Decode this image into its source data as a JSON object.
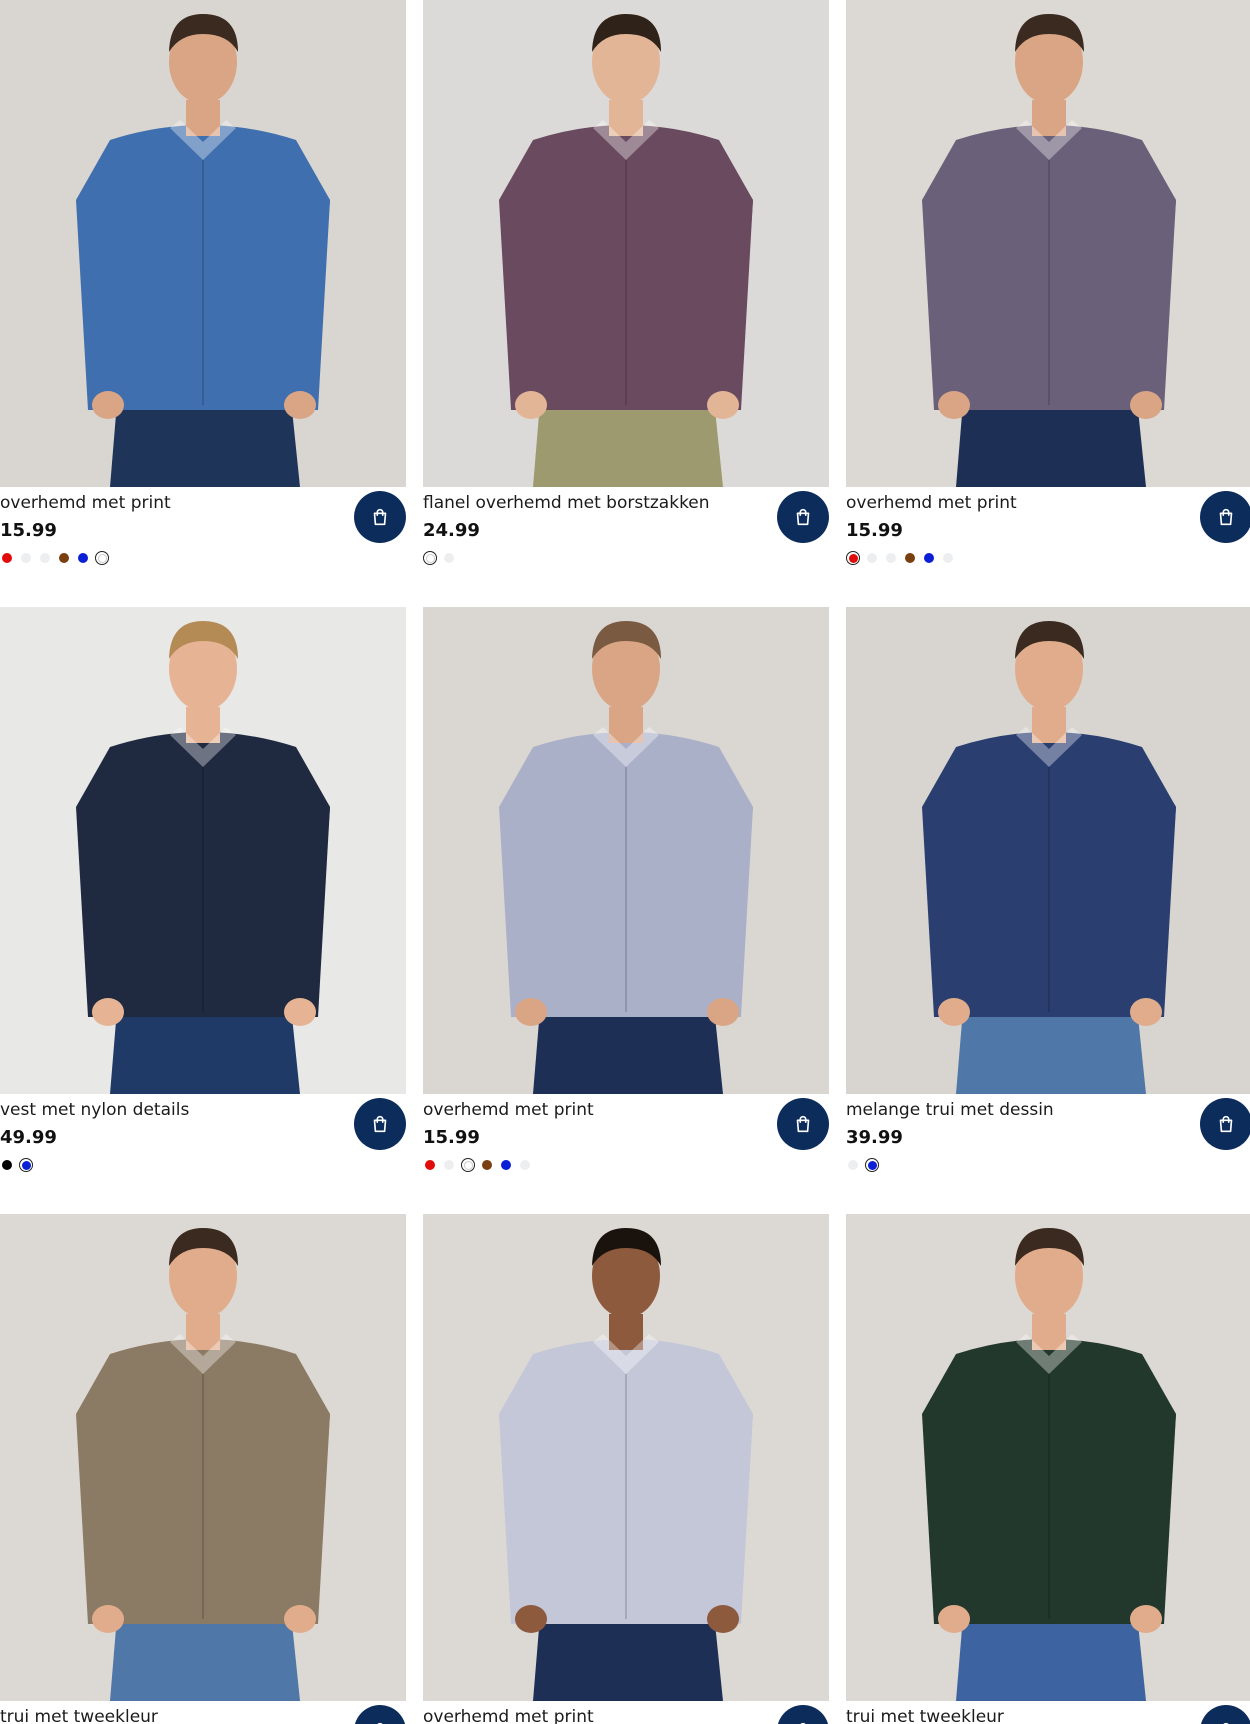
{
  "products": [
    {
      "title": "overhemd met print",
      "price": "15.99",
      "image": "man-blue-printed-shirt",
      "bg": "#d9d5d0",
      "top": "#3f6fae",
      "bottom": "#1e3559",
      "skin": "#d9a585",
      "hair": "#3a2a20",
      "swatches": [
        "#e10b0b",
        "#eceef0",
        "#eceef0",
        "#7a3f0e",
        "#0a1fd6",
        "#ffffff"
      ],
      "selected": 5
    },
    {
      "title": "flanel overhemd met borstzakken",
      "price": "24.99",
      "image": "man-plaid-flannel-shirt",
      "bg": "#dcdad8",
      "top": "#6a4a5e",
      "bottom": "#9c9a6e",
      "skin": "#e2b596",
      "hair": "#2f2219",
      "swatches": [
        "#ffffff",
        "#eceef0"
      ],
      "selected": 0
    },
    {
      "title": "overhemd met print",
      "price": "15.99",
      "image": "man-purple-printed-shirt",
      "bg": "#dcd8d3",
      "top": "#6a607a",
      "bottom": "#1d2f55",
      "skin": "#d9a585",
      "hair": "#3a2a20",
      "swatches": [
        "#e10b0b",
        "#eceef0",
        "#eceef0",
        "#7a3f0e",
        "#0a1fd6",
        "#eceef0"
      ],
      "selected": 0
    },
    {
      "title": "vest met nylon details",
      "price": "49.99",
      "image": "man-navy-zip-cardigan",
      "bg": "#e8e8e6",
      "top": "#1f2940",
      "bottom": "#1f3a66",
      "skin": "#e6b494",
      "hair": "#b48a55",
      "swatches": [
        "#000000",
        "#0a1fd6"
      ],
      "selected": 1
    },
    {
      "title": "overhemd met print",
      "price": "15.99",
      "image": "man-white-printed-shirt-beanie",
      "bg": "#dad7d3",
      "top": "#aab0c8",
      "bottom": "#1d2f55",
      "skin": "#d9a585",
      "hair": "#7a5a40",
      "swatches": [
        "#e10b0b",
        "#eceef0",
        "#ffffff",
        "#7a3f0e",
        "#0a1fd6",
        "#eceef0"
      ],
      "selected": 2
    },
    {
      "title": "melange trui met dessin",
      "price": "39.99",
      "image": "man-blue-melange-sweater",
      "bg": "#d8d5d1",
      "top": "#2a3e70",
      "bottom": "#4f77a8",
      "skin": "#e0ac8c",
      "hair": "#3a2a20",
      "swatches": [
        "#eceef0",
        "#0a1fd6"
      ],
      "selected": 1
    },
    {
      "title": "trui met tweekleur",
      "price": "",
      "image": "man-beige-knit-sweater",
      "bg": "#dcd8d3",
      "top": "#8b7a64",
      "bottom": "#4f77a8",
      "skin": "#e0ac8c",
      "hair": "#3a2a20",
      "swatches": [],
      "selected": -1
    },
    {
      "title": "overhemd met print",
      "price": "",
      "image": "man-light-printed-shirt-smiling",
      "bg": "#dcd9d5",
      "top": "#c3c7d8",
      "bottom": "#1d2f55",
      "skin": "#8e5a3e",
      "hair": "#1a120d",
      "swatches": [],
      "selected": -1
    },
    {
      "title": "trui met tweekleur",
      "price": "",
      "image": "man-green-knit-sweater",
      "bg": "#dcd8d3",
      "top": "#23382c",
      "bottom": "#3d64a0",
      "skin": "#e0ac8c",
      "hair": "#3a2a20",
      "swatches": [],
      "selected": -1
    }
  ],
  "cart_icon": "shopping-bag-icon",
  "cart_button_color": "#0c2c5c"
}
